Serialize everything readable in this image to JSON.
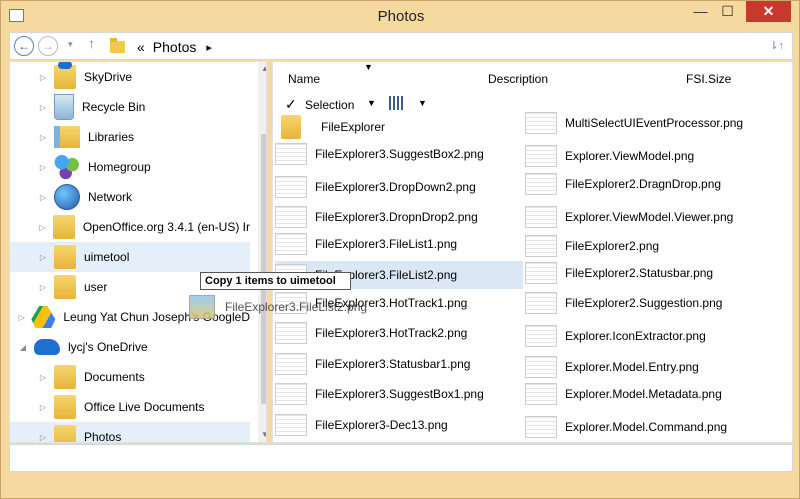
{
  "window": {
    "title": "Photos"
  },
  "controls": {
    "minimize": "—",
    "maximize": "☐",
    "close": "✕"
  },
  "nav": {
    "back": "←",
    "forward": "→",
    "recent": "▾",
    "up": "↑",
    "chevrons": "«",
    "path": "Photos",
    "path_arrow": "▸",
    "refresh": "⇂↑"
  },
  "tree": [
    {
      "label": "SkyDrive",
      "icon": "skydrive-icon"
    },
    {
      "label": "Recycle Bin",
      "icon": "recycle-bin-icon"
    },
    {
      "label": "Libraries",
      "icon": "libraries-icon"
    },
    {
      "label": "Homegroup",
      "icon": "homegroup-icon"
    },
    {
      "label": "Network",
      "icon": "network-icon"
    },
    {
      "label": "OpenOffice.org 3.4.1 (en-US) Ir",
      "icon": "folder-icon"
    },
    {
      "label": "uimetool",
      "icon": "folder-icon"
    },
    {
      "label": "user",
      "icon": "folder-icon"
    },
    {
      "label": "Leung Yat Chun Joseph's GoogleD",
      "icon": "google-drive-icon"
    },
    {
      "label": "lycj's OneDrive",
      "icon": "onedrive-icon"
    },
    {
      "label": "Documents",
      "icon": "folder-icon"
    },
    {
      "label": "Office Live Documents",
      "icon": "folder-icon"
    },
    {
      "label": "Photos",
      "icon": "folder-icon"
    }
  ],
  "columns": {
    "name": "Name",
    "description": "Description",
    "size": "FSI.Size"
  },
  "toolbar": {
    "selection": "Selection",
    "check": "✓",
    "dropdown": "▼"
  },
  "files_left": [
    "FileExplorer",
    "FileExplorer3.SuggestBox2.png",
    "FileExplorer3.DropDown2.png",
    "FileExplorer3.DropnDrop2.png",
    "FileExplorer3.FileList1.png",
    "FileExplorer3.FileList2.png",
    "FileExplorer3.HotTrack1.png",
    "FileExplorer3.HotTrack2.png",
    "FileExplorer3.Statusbar1.png",
    "FileExplorer3.SuggestBox1.png",
    "FileExplorer3-Dec13.png"
  ],
  "files_right": [
    "MultiSelectUIEventProcessor.png",
    "Explorer.ViewModel.png",
    "FileExplorer2.DragnDrop.png",
    "Explorer.ViewModel.Viewer.png",
    "FileExplorer2.png",
    "FileExplorer2.Statusbar.png",
    "FileExplorer2.Suggestion.png",
    "Explorer.IconExtractor.png",
    "Explorer.Model.Entry.png",
    "Explorer.Model.Metadata.png",
    "Explorer.Model.Command.png"
  ],
  "drag": {
    "tooltip": "Copy 1 items to uimetool",
    "ghost_label": "FileExplorer3.FileList2.png"
  }
}
